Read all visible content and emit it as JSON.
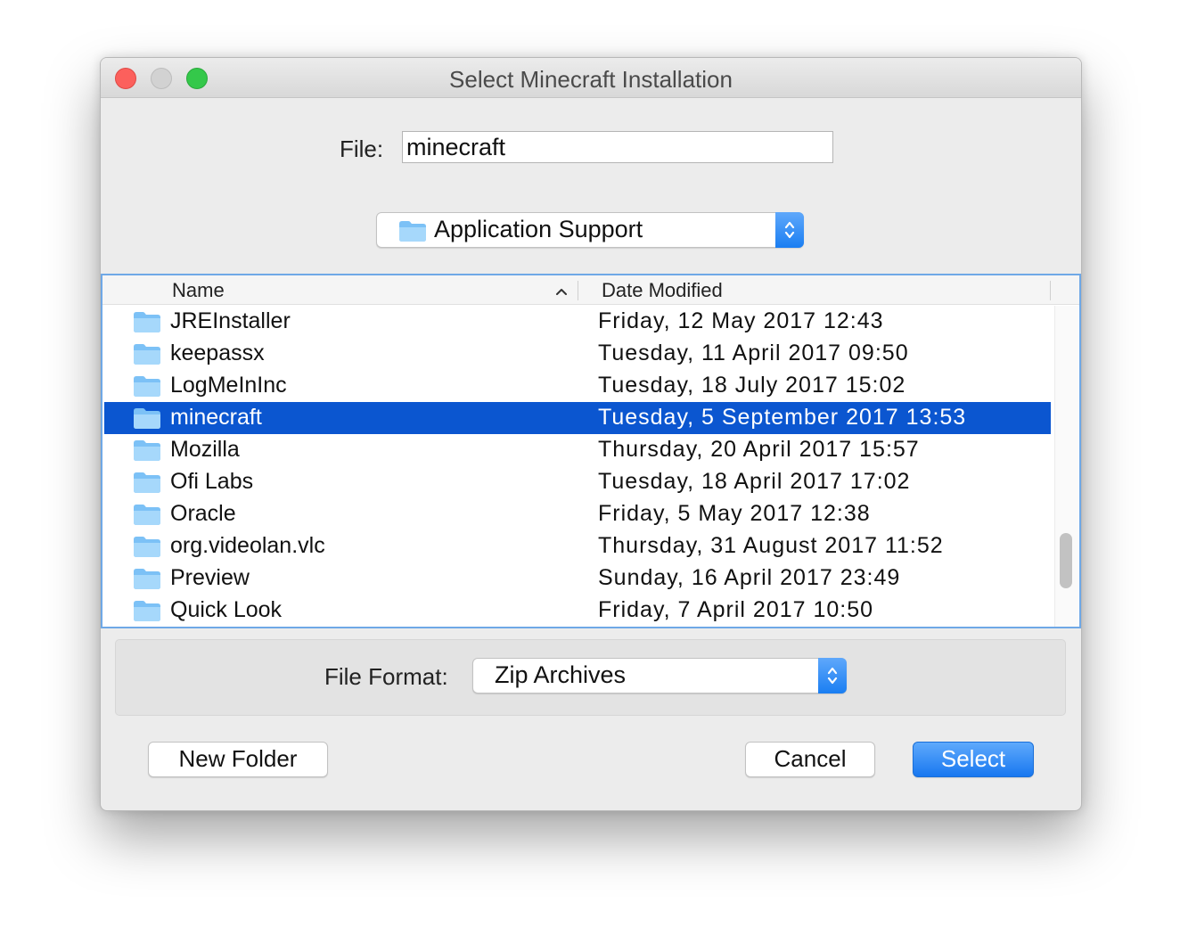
{
  "window": {
    "title": "Select Minecraft Installation"
  },
  "file": {
    "label": "File:",
    "value": "minecraft"
  },
  "location": {
    "current": "Application Support",
    "icon": "folder-icon"
  },
  "list": {
    "columns": [
      "Name",
      "Date Modified"
    ],
    "sort_indicator": "ascending",
    "rows": [
      {
        "name": "JREInstaller",
        "date": "Friday, 12 May 2017 12:43"
      },
      {
        "name": "keepassx",
        "date": "Tuesday, 11 April 2017 09:50"
      },
      {
        "name": "LogMeInInc",
        "date": "Tuesday, 18 July 2017 15:02"
      },
      {
        "name": "minecraft",
        "date": "Tuesday, 5 September 2017 13:53",
        "selected": true
      },
      {
        "name": "Mozilla",
        "date": "Thursday, 20 April 2017 15:57"
      },
      {
        "name": "Ofi Labs",
        "date": "Tuesday, 18 April 2017 17:02"
      },
      {
        "name": "Oracle",
        "date": "Friday, 5 May 2017 12:38"
      },
      {
        "name": "org.videolan.vlc",
        "date": "Thursday, 31 August 2017 11:52"
      },
      {
        "name": "Preview",
        "date": "Sunday, 16 April 2017 23:49"
      },
      {
        "name": "Quick Look",
        "date": "Friday, 7 April 2017 10:50"
      }
    ]
  },
  "format": {
    "label": "File Format:",
    "value": "Zip Archives"
  },
  "buttons": {
    "new_folder": "New Folder",
    "cancel": "Cancel",
    "select": "Select"
  },
  "colors": {
    "selection": "#0b56d0",
    "accent": "#1a7ef2",
    "close": "#fc605c",
    "maximize": "#34c84a"
  }
}
